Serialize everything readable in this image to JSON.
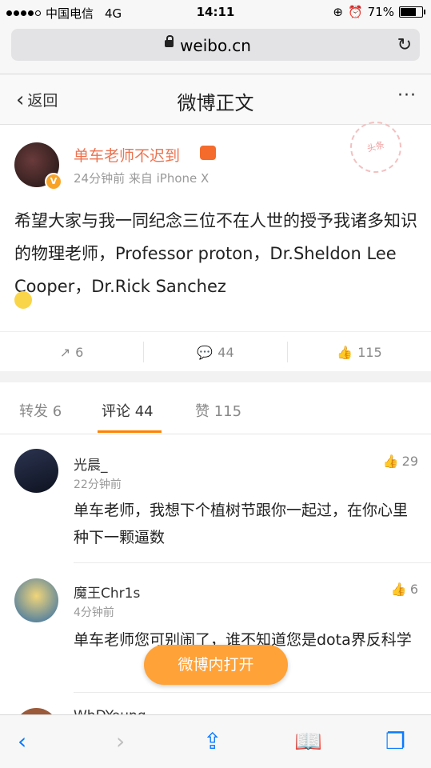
{
  "status_bar": {
    "carrier": "中国电信",
    "network": "4G",
    "time": "14:11",
    "battery": "71%"
  },
  "browser": {
    "url": "weibo.cn"
  },
  "nav": {
    "back_label": "返回",
    "title": "微博正文",
    "more": "···"
  },
  "post": {
    "author": "单车老师不迟到",
    "meta": "24分钟前 来自 iPhone X",
    "stamp": "头条",
    "text": "希望大家与我一同纪念三位不在人世的授予我诸多知识的物理老师，Professor proton，Dr.Sheldon Lee Cooper，Dr.Rick Sanchez",
    "reposts": "6",
    "comments": "44",
    "likes": "115"
  },
  "tabs": {
    "repost": "转发 6",
    "comment": "评论 44",
    "like": "赞 115"
  },
  "comments": [
    {
      "name": "光晨_",
      "time": "22分钟前",
      "likes": "29",
      "text": "单车老师，我想下个植树节跟你一起过，在你心里种下一颗逼数"
    },
    {
      "name": "魔王Chr1s",
      "time": "4分钟前",
      "likes": "6",
      "text": "单车老师您可别闹了，谁不知道您是dota界反科学"
    },
    {
      "name": "WhDYoung",
      "time": "",
      "likes": "",
      "text": ""
    }
  ],
  "open_button": "微博内打开",
  "colors": {
    "accent_orange": "#ff8200",
    "author_name": "#eb7350",
    "ios_blue": "#0a7aff",
    "button_orange": "#ffa238"
  }
}
